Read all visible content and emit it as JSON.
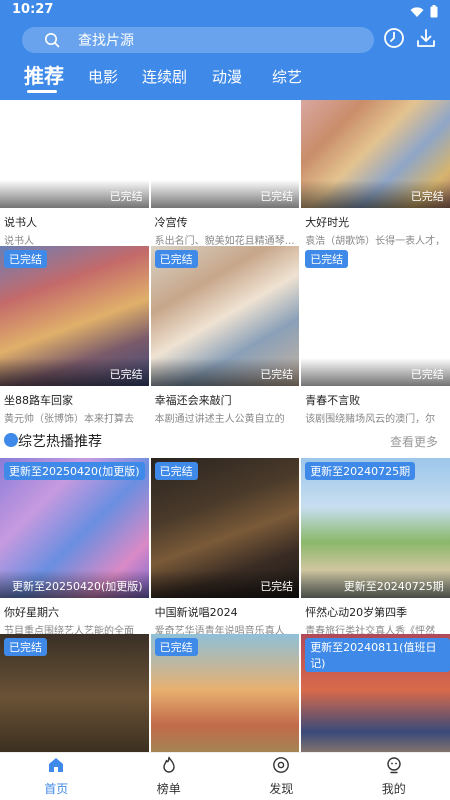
{
  "status_bar": {
    "time": "10:27"
  },
  "search": {
    "placeholder": "查找片源"
  },
  "tabs": [
    {
      "label": "推荐",
      "active": true
    },
    {
      "label": "电影"
    },
    {
      "label": "连续剧"
    },
    {
      "label": "动漫"
    },
    {
      "label": "综艺"
    }
  ],
  "grid_top": [
    {
      "title": "说书人",
      "desc": "说书人",
      "status": "已完结",
      "badge": ""
    },
    {
      "title": "冷宫传",
      "desc": "系出名门、貌美如花且精通琴棋书",
      "status": "已完结",
      "badge": ""
    },
    {
      "title": "大好时光",
      "desc": "袁浩（胡歌饰）长得一表人才，",
      "status": "已完结",
      "badge": ""
    },
    {
      "title": "坐88路车回家",
      "desc": "黄元帅（张博饰）本来打算去",
      "status": "已完结",
      "badge": "已完结"
    },
    {
      "title": "幸福还会来敲门",
      "desc": "本剧通过讲述主人公黄自立的",
      "status": "已完结",
      "badge": "已完结"
    },
    {
      "title": "青春不言败",
      "desc": "该剧围绕赌场风云的澳门，尔",
      "status": "已完结",
      "badge": "已完结"
    }
  ],
  "variety_section": {
    "title": "综艺热播推荐",
    "more": "查看更多",
    "items": [
      {
        "title": "你好星期六",
        "desc": "节目重点围绕艺人艺能的全面",
        "status": "更新至20250420(加更版)",
        "badge": "更新至20250420(加更版)"
      },
      {
        "title": "中国新说唱2024",
        "desc": "爱奇艺华语青年说唱音乐真人",
        "status": "已完结",
        "badge": "已完结"
      },
      {
        "title": "怦然心动20岁第四季",
        "desc": "青春旅行类社交真人秀《怦然",
        "status": "更新至20240725期",
        "badge": "更新至20240725期"
      },
      {
        "title": "",
        "desc": "",
        "status": "",
        "badge": "已完结"
      },
      {
        "title": "",
        "desc": "",
        "status": "",
        "badge": "已完结"
      },
      {
        "title": "",
        "desc": "",
        "status": "",
        "badge": "更新至20240811(值班日记)"
      }
    ]
  },
  "bottom_nav": [
    {
      "label": "首页",
      "icon": "home-icon",
      "active": true
    },
    {
      "label": "榜单",
      "icon": "flame-icon"
    },
    {
      "label": "发现",
      "icon": "discover-icon"
    },
    {
      "label": "我的",
      "icon": "profile-icon"
    }
  ],
  "colors": {
    "accent": "#3f8ae8",
    "header": "#3f8ae8"
  }
}
